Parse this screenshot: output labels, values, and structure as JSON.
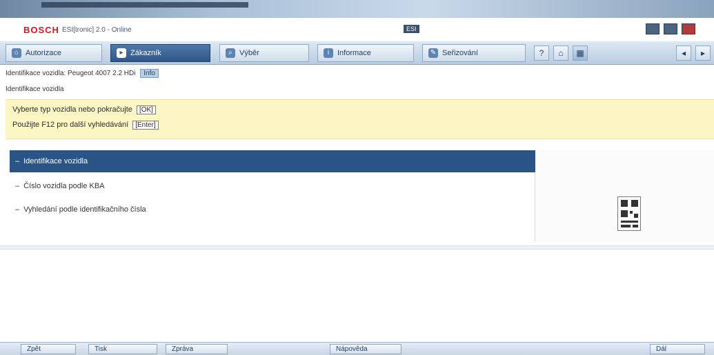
{
  "window": {
    "logo": "BOSCH",
    "title": "ESI[tronic] 2.0 - Online",
    "tag": "ESI",
    "controls": [
      "_",
      "□",
      "×"
    ]
  },
  "toolbar": {
    "buttons": [
      {
        "label": "Autorizace",
        "icon": "home-icon",
        "active": false
      },
      {
        "label": "Zákazník",
        "icon": "car-icon",
        "active": true
      },
      {
        "label": "Výběr",
        "icon": "search-icon",
        "active": false
      },
      {
        "label": "Informace",
        "icon": "info-icon",
        "active": false
      },
      {
        "label": "Seřizování",
        "icon": "wrench-icon",
        "active": false
      }
    ],
    "small_buttons": [
      "?",
      "⌂",
      "▦",
      "◂",
      "▸"
    ]
  },
  "info": {
    "text": "Identifikace vozidla: Peugeot 4007 2.2 HDi",
    "badge": "Info"
  },
  "subtitle": "Identifikace vozidla",
  "notice": {
    "line1_text": "Vyberte typ vozidla nebo pokračujte",
    "line1_key": "[OK]",
    "line2_text": "Použijte F12 pro další vyhledávání",
    "line2_key": "[Enter]"
  },
  "list": {
    "items": [
      {
        "label": "Identifikace vozidla",
        "selected": true
      },
      {
        "label": "Číslo vozidla podle KBA",
        "selected": false
      },
      {
        "label": "Vyhledání podle identifikačního čísla",
        "selected": false
      }
    ]
  },
  "statusbar": {
    "buttons": [
      "Zpět",
      "Tisk",
      "Zpráva",
      "Nápověda",
      "Dál"
    ]
  },
  "colors": {
    "selected_row": "#2a5486",
    "notice_bg": "#fbf6c4",
    "brand_red": "#d8141a"
  }
}
